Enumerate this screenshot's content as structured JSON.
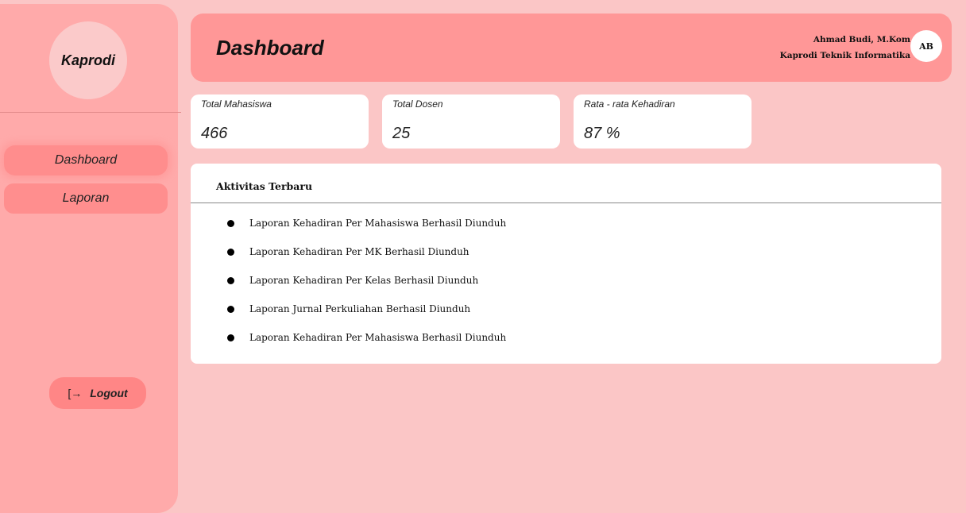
{
  "sidebar": {
    "brand": "Kaprodi",
    "nav": [
      {
        "label": "Dashboard"
      },
      {
        "label": "Laporan"
      }
    ],
    "logout_icon": "logout-arrow-icon",
    "logout_label": "Logout"
  },
  "header": {
    "title": "Dashboard",
    "user_name": "Ahmad Budi, M.Kom",
    "user_role": "Kaprodi Teknik Informatika",
    "avatar_initials": "AB"
  },
  "stats": [
    {
      "label": "Total Mahasiswa",
      "value": "466"
    },
    {
      "label": "Total Dosen",
      "value": "25"
    },
    {
      "label": "Rata - rata Kehadiran",
      "value": "87 %"
    }
  ],
  "activity": {
    "title": "Aktivitas Terbaru",
    "items": [
      "Laporan Kehadiran Per Mahasiswa Berhasil Diunduh",
      "Laporan Kehadiran Per  MK  Berhasil Diunduh",
      "Laporan Kehadiran Per Kelas Berhasil Diunduh",
      "Laporan Jurnal Perkuliahan Berhasil Diunduh",
      "Laporan Kehadiran Per Mahasiswa Berhasil Diunduh"
    ]
  },
  "colors": {
    "background": "#fbc6c6",
    "sidebar": "#ffaaaa",
    "header": "#ff9797",
    "nav_active": "#ff8d8d",
    "logout_button": "#ff8686"
  }
}
